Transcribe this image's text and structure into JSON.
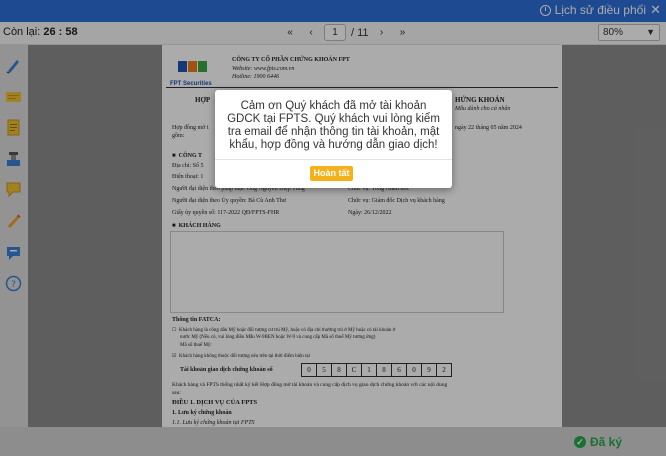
{
  "header": {
    "history_label": "Lịch sử điều phối",
    "close_label": "✕"
  },
  "toolbar": {
    "timer_label": "Còn lại:",
    "timer_value": "26 : 58",
    "first_page": "«",
    "prev_page": "‹",
    "current_page": "1",
    "total_pages": "/ 11",
    "next_page": "›",
    "last_page": "»",
    "zoom_value": "80%"
  },
  "document": {
    "company_name": "CÔNG TY CỔ PHẦN CHỨNG KHOÁN FPT",
    "website": "Website: www.fpts.com.vn",
    "hotline": "Hotline: 1900 6446",
    "logo_text": "FPT Securities",
    "title_left": "HỢP",
    "title_right": "HỨNG KHOÁN",
    "sample_note": "Mẫu dành cho cá nhân",
    "intro_left": "Hợp đồng mở t",
    "intro_right": "ngày 22 tháng 05 năm 2024",
    "intro_line2": "gồm:",
    "section_cong_ty": "CÔNG T",
    "addr": "Địa chỉ: Số 5",
    "phone": "Điện thoại: 1",
    "rep_left": "Người đại diện theo pháp luật: Ông Nguyễn Điệp Tùng",
    "rep_right": "Chức vụ: Tổng Giám đốc",
    "auth_left": "Người đại diện theo Ủy quyền: Bà Cù Anh Thư",
    "auth_right": "Chức vụ: Giám đốc Dịch vụ khách hàng",
    "decision_left": "Giấy ủy quyền số: 117-2022 QĐ/FPTS-FHR",
    "decision_right": "Ngày: 26/12/2022",
    "section_khach_hang": "KHÁCH HÀNG",
    "fatca_title": "Thông tin FATCA:",
    "fatca_1": "Khách hàng là công dân Mỹ hoặc đối tượng cư trú Mỹ, hoặc có địa chỉ thường trú ở Mỹ hoặc có tài khoản ở",
    "fatca_1b": "nước Mỹ (Nếu có, vui lòng điền Mẫu W-9BEN hoặc W-9 và cung cấp Mã số thuế Mỹ tương ứng)",
    "fatca_1c": "Mã số thuế Mỹ:",
    "fatca_2": "Khách hàng không thuộc đối tượng nêu trên tại thời điểm hiện tại",
    "account_label": "Tài khoản giao dịch chứng khoán số",
    "account_digits": [
      "0",
      "5",
      "8",
      "C",
      "1",
      "8",
      "6",
      "0",
      "9",
      "2"
    ],
    "agree_text": "Khách hàng và FPTS thống nhất ký kết Hợp đồng mở tài khoản và cung cấp dịch vụ giao dịch chứng khoán với các nội dung",
    "agree_text2": "sau:",
    "article_1": "ĐIỀU 1.  DỊCH VỤ CỦA FPTS",
    "article_1_1": "1.      Lưu ký chứng khoán",
    "article_1_1_1": "1.1.    Lưu ký chứng khoán tại FPTS"
  },
  "modal": {
    "message": "Cảm ơn Quý khách đã mở tài khoản GDCK tại FPTS. Quý khách vui lòng kiểm tra email để nhận thông tin tài khoản, mật khẩu, hợp đồng và hướng dẫn giao dịch!",
    "confirm_label": "Hoàn tất"
  },
  "footer": {
    "signed_label": "Đã ký"
  },
  "colors": {
    "header_blue": "#2e6fd8",
    "confirm_orange": "#f5b11a",
    "signed_green": "#27a84a"
  }
}
